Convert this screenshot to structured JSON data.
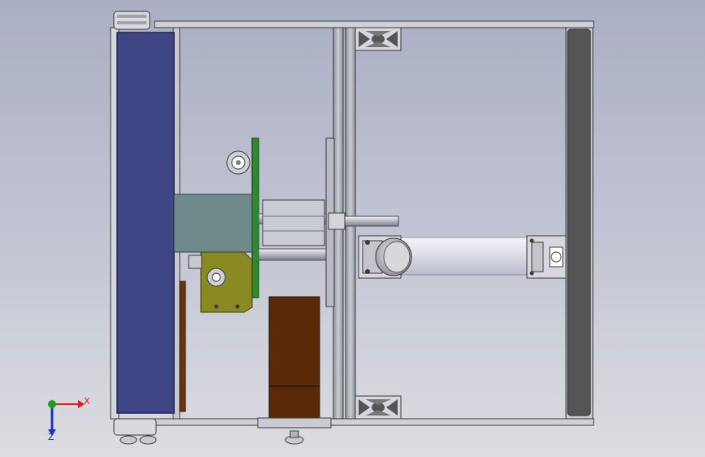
{
  "view": {
    "background_top": "#a9afc3",
    "background_bottom": "#dcdde2",
    "frame_color": "#c9ccd2",
    "edge_color": "#3a3a3a"
  },
  "parts": {
    "conveyor_belt": {
      "color": "#404586"
    },
    "motor_block": {
      "color": "#6f8a8a"
    },
    "gearbox_bracket": {
      "color": "#8a8a24"
    },
    "pcb_board": {
      "color": "#2e8a2e"
    },
    "stepper_motor": {
      "color": "#5a2a08"
    },
    "end_plate": {
      "color": "#555555"
    },
    "shaft": {
      "color": "#d6d8e0"
    },
    "roller_tube": {
      "color": "#e8eaf2"
    }
  },
  "triad": {
    "x_label": "X",
    "z_label": "Z",
    "x_color": "#d42020",
    "y_color": "#18a018",
    "z_color": "#2030c8"
  }
}
